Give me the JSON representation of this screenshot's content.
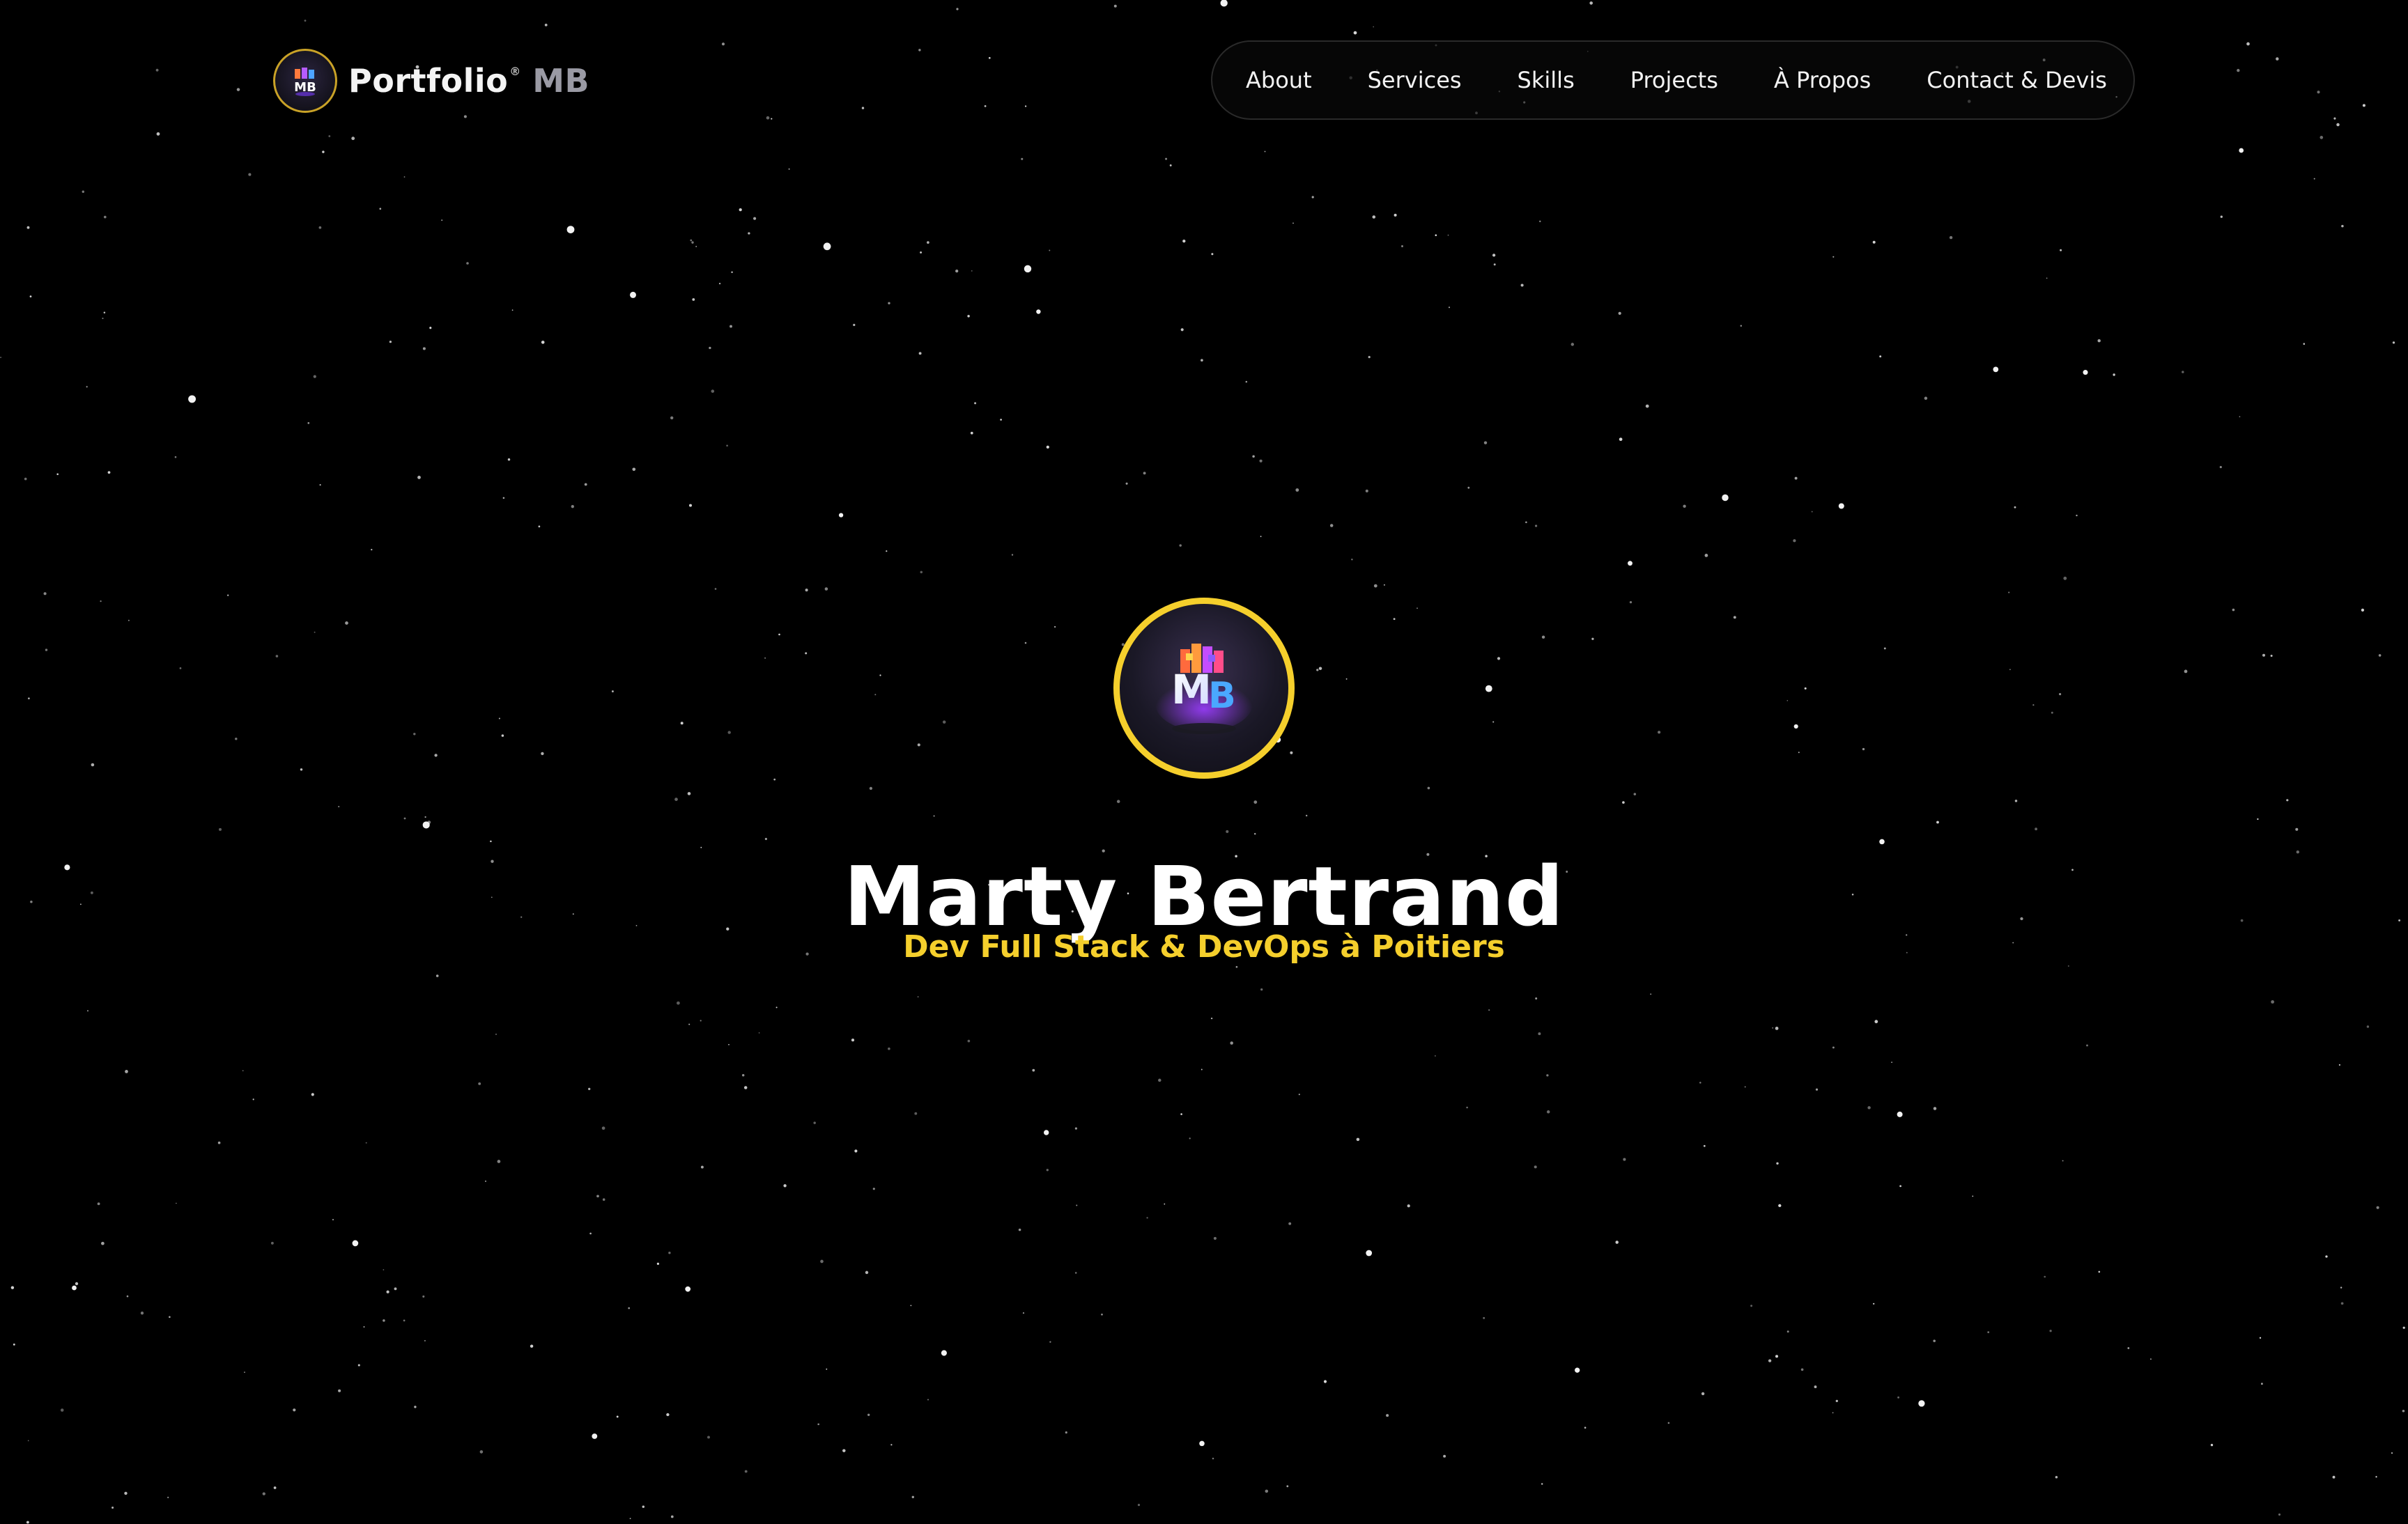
{
  "header": {
    "brand": {
      "logo_icon": "mb-cube-logo-icon",
      "name": "Portfolio",
      "trademark": "®",
      "accent": "MB"
    },
    "nav": {
      "items": [
        {
          "label": "About"
        },
        {
          "label": "Services"
        },
        {
          "label": "Skills"
        },
        {
          "label": "Projects"
        },
        {
          "label": "À Propos"
        },
        {
          "label": "Contact & Devis"
        }
      ]
    }
  },
  "hero": {
    "avatar_icon": "mb-cube-avatar-icon",
    "name": "Marty Bertrand",
    "subtitle": "Dev Full Stack & DevOps à Poitiers"
  },
  "colors": {
    "background": "#000000",
    "accent": "#f5cf2c",
    "text": "#ffffff"
  }
}
